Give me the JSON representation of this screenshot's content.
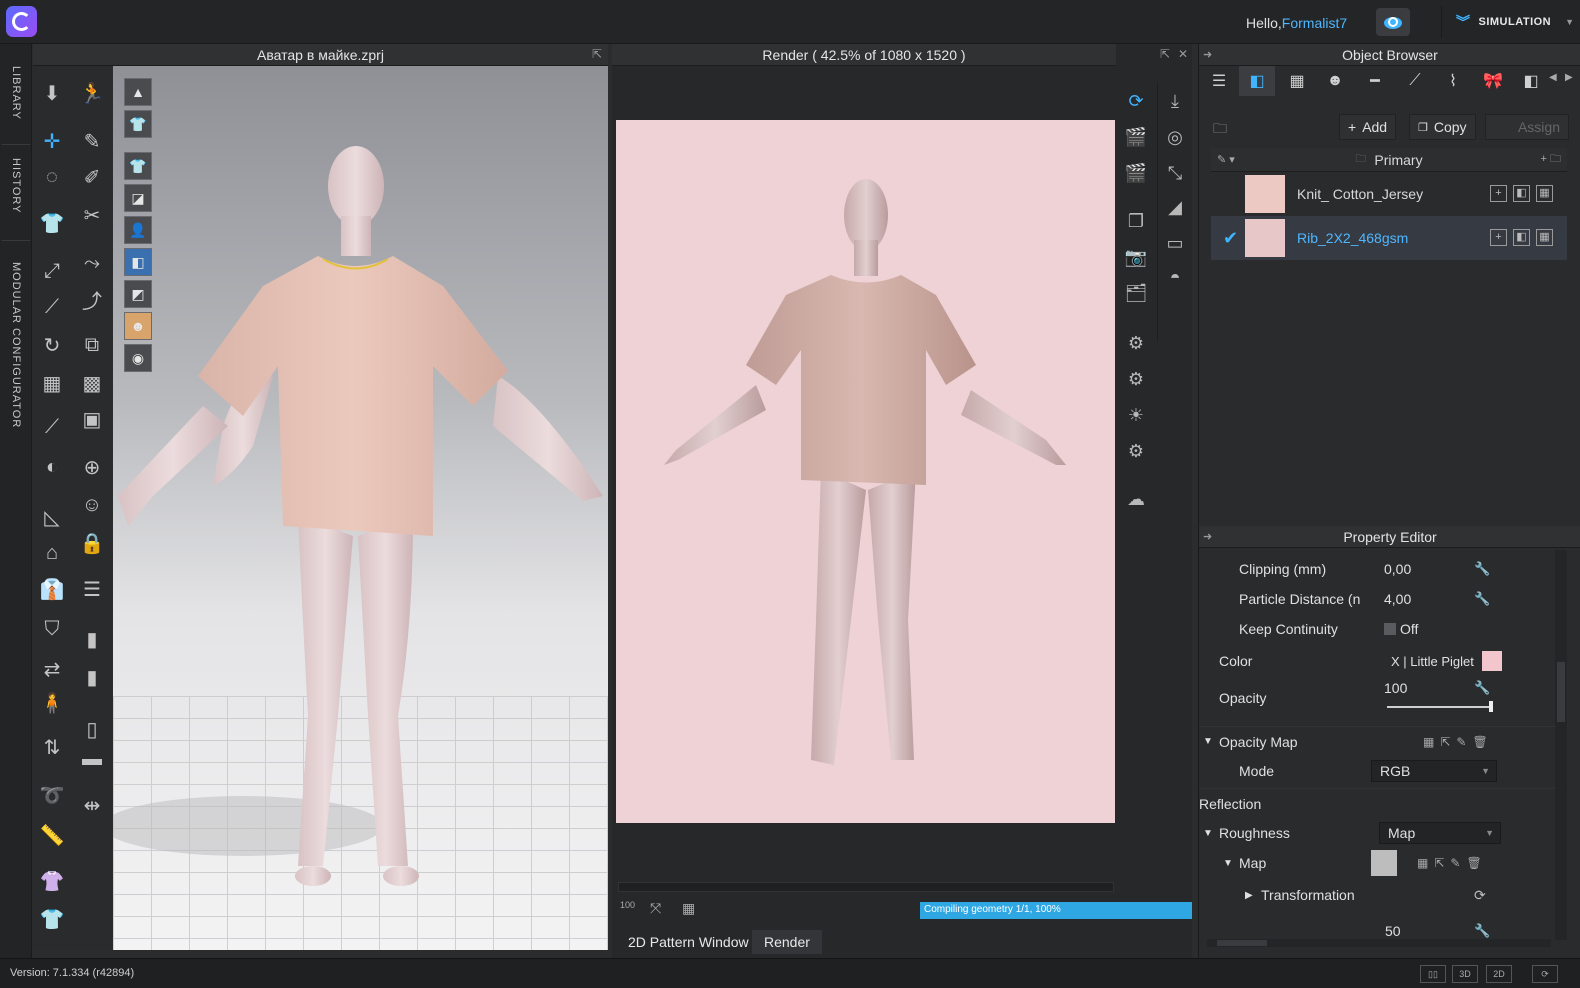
{
  "topbar": {
    "greeting": "Hello,",
    "username": "Formalist7",
    "mode_button": "SIMULATION"
  },
  "side_tabs": [
    "LIBRARY",
    "HISTORY",
    "MODULAR CONFIGURATOR"
  ],
  "viewport3d": {
    "title": "Аватар в майке.zprj"
  },
  "render": {
    "title": "Render ( 42.5% of 1080 x 1520 )",
    "progress_text": "Compiling geometry 1/1, 100%",
    "zoom_label": "100",
    "bottom_tabs": [
      "2D Pattern Window",
      "Render"
    ]
  },
  "object_browser": {
    "title": "Object Browser",
    "add_label": "Add",
    "copy_label": "Copy",
    "assign_label": "Assign",
    "group_label": "Primary",
    "materials": [
      {
        "name": "Knit_ Cotton_Jersey",
        "color": "#ecc9c2",
        "selected": false
      },
      {
        "name": "Rib_2X2_468gsm",
        "color": "#e8c7c8",
        "selected": true
      }
    ]
  },
  "property_editor": {
    "title": "Property Editor",
    "clipping_label": "Clipping (mm)",
    "clipping_value": "0,00",
    "particle_label": "Particle Distance (n",
    "particle_value": "4,00",
    "continuity_label": "Keep Continuity",
    "continuity_value": "Off",
    "color_label": "Color",
    "color_value": "X | Little Piglet",
    "color_swatch": "#f2c6cc",
    "opacity_label": "Opacity",
    "opacity_value": "100",
    "opacity_map_label": "Opacity Map",
    "mode_label": "Mode",
    "mode_value": "RGB",
    "reflection_label": "Reflection",
    "roughness_label": "Roughness",
    "roughness_value": "Map",
    "map_label": "Map",
    "transformation_label": "Transformation",
    "last_value": "50"
  },
  "status": {
    "version": "Version: 7.1.334 (r42894)",
    "view_3d": "3D",
    "view_2d": "2D"
  },
  "colors": {
    "accent": "#4fb7ff",
    "progress": "#2fa7e3",
    "render_bg": "#efd2d6"
  }
}
